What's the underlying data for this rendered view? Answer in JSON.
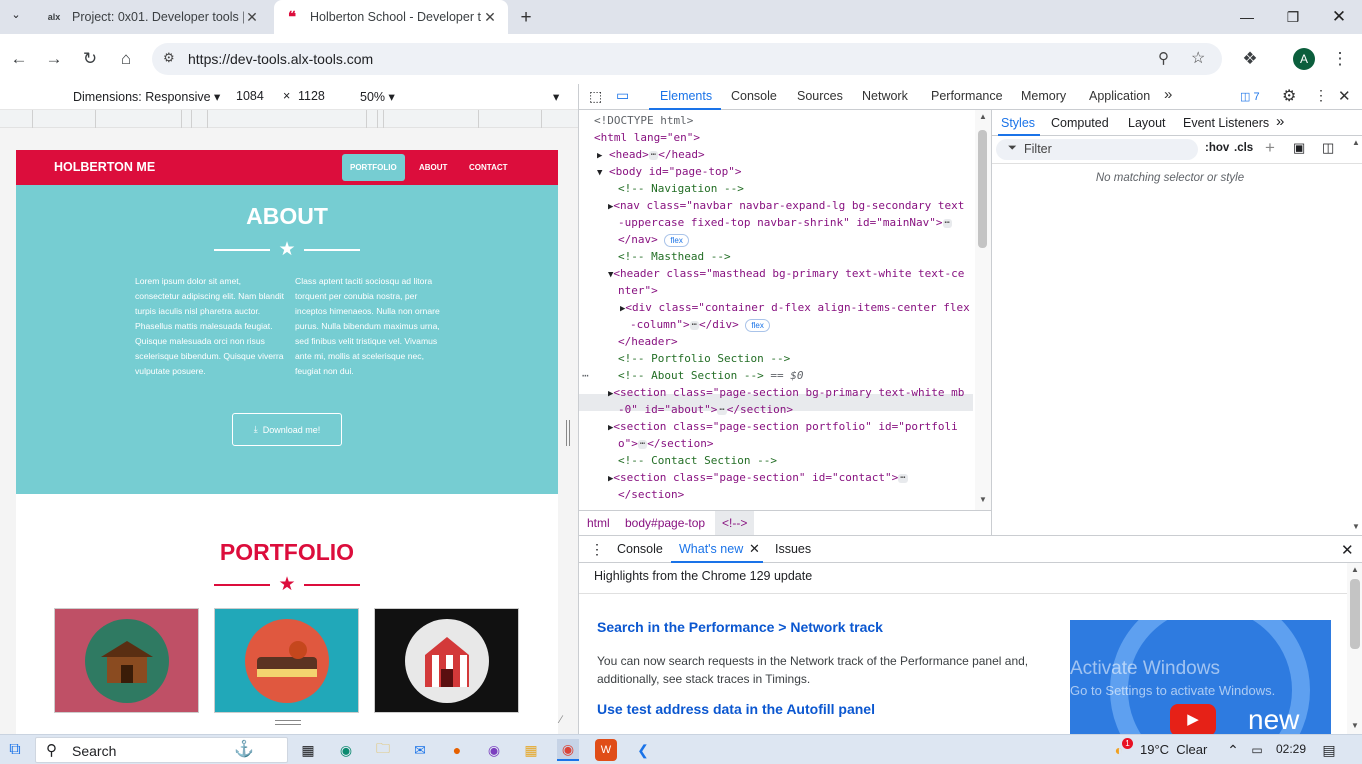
{
  "browser": {
    "tabs": [
      {
        "title": "Project: 0x01. Developer tools |",
        "favicon": "alx",
        "active": false
      },
      {
        "title": "Holberton School - Developer t",
        "favicon": "holberton-icon",
        "active": true
      }
    ],
    "url": "https://dev-tools.alx-tools.com",
    "avatar_letter": "A"
  },
  "device_toolbar": {
    "dimensions_label": "Dimensions: Responsive",
    "width": "1084",
    "times": "×",
    "height": "1128",
    "zoom": "50%"
  },
  "page": {
    "brand": "HOLBERTON ME",
    "nav": [
      "PORTFOLIO",
      "ABOUT",
      "CONTACT"
    ],
    "about_title": "ABOUT",
    "about_left": "Lorem ipsum dolor sit amet, consectetur adipiscing elit. Nam blandit turpis iaculis nisl pharetra auctor. Phasellus mattis malesuada feugiat. Quisque malesuada orci non risus scelerisque bibendum. Quisque viverra vulputate posuere.",
    "about_right": "Class aptent taciti sociosqu ad litora torquent per conubia nostra, per inceptos himenaeos. Nulla non ornare purus. Nulla bibendum maximus urna, sed finibus velit tristique vel. Vivamus ante mi, mollis at scelerisque nec, feugiat non dui.",
    "download_label": "Download me!",
    "portfolio_title": "PORTFOLIO",
    "colors": {
      "primary": "#76cdd2",
      "secondary": "#dc0d3c"
    }
  },
  "devtools": {
    "tabs": [
      "Elements",
      "Console",
      "Sources",
      "Network",
      "Performance",
      "Memory",
      "Application"
    ],
    "issues_count": "7",
    "dom": {
      "doctype": "<!DOCTYPE html>",
      "html_open": "<html lang=\"en\">",
      "head": "<head>",
      "head_close": "</head>",
      "body_open": "<body id=\"page-top\">",
      "c_nav": "<!-- Navigation -->",
      "nav_a": "<nav class=\"navbar navbar-expand-lg bg-secondary text",
      "nav_b": "-uppercase fixed-top navbar-shrink\" id=\"mainNav\">",
      "nav_close": "</nav>",
      "c_mast": "<!-- Masthead -->",
      "header_a": "<header class=\"masthead bg-primary text-white text-ce",
      "header_b": "nter\">",
      "div_a": "<div class=\"container d-flex align-items-center flex",
      "div_b": "-column\">",
      "div_close": "</div>",
      "header_close": "</header>",
      "c_port": "<!-- Portfolio Section -->",
      "c_about": "<!-- About Section -->",
      "eq0": "== $0",
      "sec1_a": "<section class=\"page-section bg-primary text-white mb",
      "sec1_b": "-0\" id=\"about\">",
      "sec_close": "</section>",
      "sec2_a": "<section class=\"page-section portfolio\" id=\"portfoli",
      "sec2_b": "o\">",
      "c_contact": "<!-- Contact Section -->",
      "sec3": "<section class=\"page-section\" id=\"contact\">",
      "flex_pill": "flex"
    },
    "breadcrumbs": [
      "html",
      "body#page-top",
      "<!-->"
    ],
    "styles_tabs": [
      "Styles",
      "Computed",
      "Layout",
      "Event Listeners"
    ],
    "filter_placeholder": "Filter",
    "hov": ":hov",
    "cls": ".cls",
    "no_match": "No matching selector or style",
    "drawer_tabs": [
      "Console",
      "What's new",
      "Issues"
    ],
    "whats_new": {
      "highlight": "Highlights from the Chrome 129 update",
      "h1": "Search in the Performance > Network track",
      "p1": "You can now search requests in the Network track of the Performance panel and, additionally, see stack traces in Timings.",
      "h2": "Use test address data in the Autofill panel",
      "img_text": "new",
      "watermark_title": "Activate Windows",
      "watermark_sub": "Go to Settings to activate Windows."
    }
  },
  "taskbar": {
    "search": "Search",
    "weather": "19°C  Clear",
    "time": "02:29",
    "badge": "1"
  }
}
